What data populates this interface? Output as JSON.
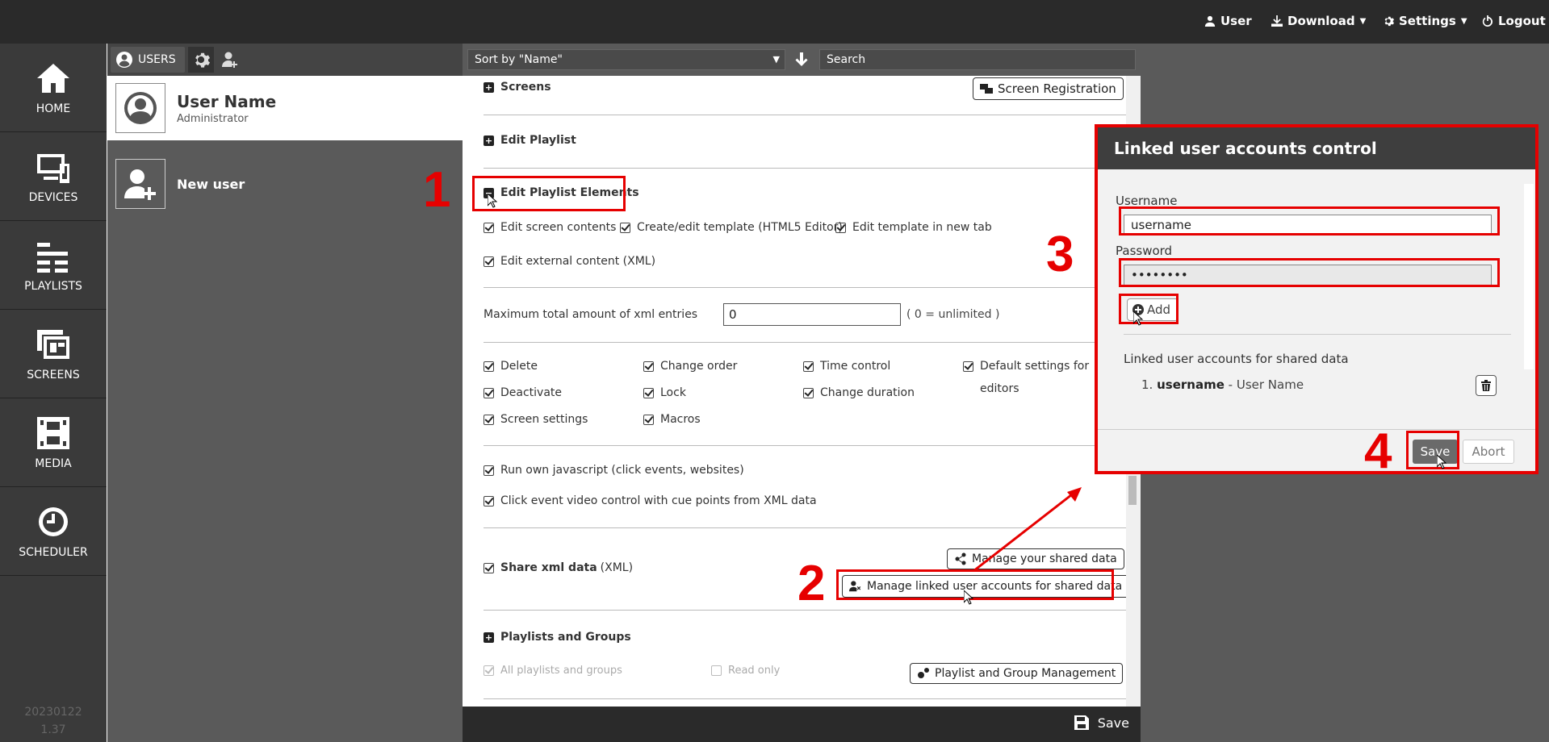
{
  "topbar": {
    "user_label": "User",
    "download_label": "Download",
    "settings_label": "Settings",
    "logout_label": "Logout"
  },
  "nav": {
    "items": [
      {
        "label": "HOME",
        "icon": "home-icon"
      },
      {
        "label": "DEVICES",
        "icon": "devices-icon"
      },
      {
        "label": "PLAYLISTS",
        "icon": "playlists-icon"
      },
      {
        "label": "SCREENS",
        "icon": "screens-icon"
      },
      {
        "label": "MEDIA",
        "icon": "media-icon"
      },
      {
        "label": "SCHEDULER",
        "icon": "clock-icon"
      }
    ],
    "version_line1": "20230122",
    "version_line2": "1.37"
  },
  "users": {
    "tab_label": "USERS",
    "list": [
      {
        "name": "User Name",
        "role": "Administrator"
      },
      {
        "name": "New user",
        "role": ""
      }
    ]
  },
  "toolbar": {
    "sort_value": "Sort by \"Name\"",
    "search_placeholder": "Search"
  },
  "main": {
    "screens_label": "Screens",
    "screen_registration_label": "Screen Registration",
    "edit_playlist_label": "Edit Playlist",
    "edit_playlist_elements_label": "Edit Playlist Elements",
    "perm_row1": [
      "Edit screen contents",
      "Create/edit template (HTML5 Editor)",
      "Edit template in new tab"
    ],
    "perm_external": "Edit external content (XML)",
    "xml_max_label": "Maximum total amount of xml entries",
    "xml_max_value": "0",
    "xml_max_hint": "( 0 = unlimited )",
    "grid": {
      "col1": [
        "Delete",
        "Deactivate",
        "Screen settings"
      ],
      "col2": [
        "Change order",
        "Lock",
        "Macros"
      ],
      "col3": [
        "Time control",
        "Change duration"
      ],
      "col4_line1": "Default settings for",
      "col4_line2": "editors"
    },
    "run_js_label": "Run own javascript (click events, websites)",
    "click_video_label": "Click event video control with cue points from XML data",
    "share_xml_label": "Share xml data",
    "share_xml_suffix": "(XML)",
    "manage_shared_label": "Manage your shared data",
    "manage_linked_label": "Manage linked user accounts for shared data",
    "playlists_groups_label": "Playlists and Groups",
    "all_playlists_label": "All playlists and groups",
    "read_only_label": "Read only",
    "playlist_group_mgmt_label": "Playlist and Group Management",
    "save_label": "Save"
  },
  "modal": {
    "title": "Linked user accounts control",
    "username_label": "Username",
    "username_value": "username",
    "password_label": "Password",
    "password_value": "••••••••",
    "add_label": "Add",
    "linked_title": "Linked user accounts for shared data",
    "linked_entry_num": "1.",
    "linked_entry_user": "username",
    "linked_entry_name": " - User Name",
    "save_label": "Save",
    "abort_label": "Abort"
  },
  "annotations": [
    "1",
    "2",
    "3",
    "4"
  ],
  "colors": {
    "annotation_red": "#e60000",
    "topbar_bg": "#2a2a2a",
    "panel_grey": "#5a5a5a"
  }
}
